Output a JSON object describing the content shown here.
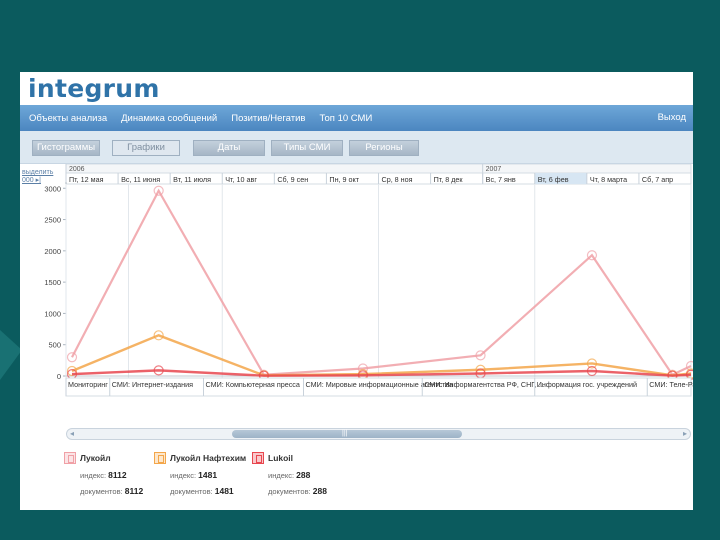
{
  "app": {
    "logo": "integrum"
  },
  "nav": {
    "items": [
      "Объекты анализа",
      "Динамика сообщений",
      "Позитив/Негатив",
      "Топ 10 СМИ"
    ],
    "exit_label": "Выход"
  },
  "toolbar": {
    "buttons": [
      "Гистограммы",
      "Графики",
      "Даты",
      "Типы СМИ",
      "Регионы"
    ],
    "active": "Графики"
  },
  "sidebar": {
    "zoom_label_1": "выделить",
    "zoom_label_2": "000 ▸|"
  },
  "colors": {
    "series_1": "#f0a0a6",
    "series_2": "#f3a64a",
    "series_3": "#e8474f",
    "nav_bg": "#5a93c9"
  },
  "chart_data": {
    "type": "line",
    "years": [
      {
        "label": "2006",
        "start_index": 0
      },
      {
        "label": "2007",
        "start_index": 8
      }
    ],
    "date_labels": [
      "Пт, 12 мая",
      "Вс, 11 июня",
      "Вт, 11 июля",
      "Чт, 10 авг",
      "Сб, 9 сен",
      "Пн, 9 окт",
      "Ср, 8 ноя",
      "Пт, 8 дек",
      "Вс, 7 янв",
      "Вт, 6 фев",
      "Чт, 8 марта",
      "Сб, 7 апр"
    ],
    "highlighted_date": "Вт, 6 фев",
    "yticks": [
      0,
      500,
      1000,
      1500,
      2000,
      2500,
      3000
    ],
    "ylim": [
      0,
      3100
    ],
    "categories": [
      "Мониторинг",
      "СМИ: Интернет-издания",
      "СМИ: Компьютерная пресса",
      "СМИ: Мировые информационные агентства",
      "СМИ: Информагентства РФ, СНГ, ...",
      "Информация гос. учреждений",
      "СМИ: Теле-Радио"
    ],
    "category_bounds": [
      0,
      0.1,
      0.25,
      0.5,
      0.75,
      1.0
    ],
    "x_points": [
      0,
      1,
      2,
      3,
      4,
      5,
      6
    ],
    "series": [
      {
        "name": "Лукойл",
        "values": [
          300,
          2960,
          20,
          120,
          330,
          1930,
          20,
          160
        ]
      },
      {
        "name": "Лукойл Нафтехим",
        "values": [
          80,
          650,
          10,
          30,
          100,
          200,
          10,
          40
        ]
      },
      {
        "name": "Lukoil",
        "values": [
          30,
          90,
          5,
          10,
          40,
          80,
          5,
          20
        ]
      }
    ]
  },
  "legend": [
    {
      "name": "Лукойл",
      "index_label": "индекс:",
      "index_value": "8112",
      "docs_label": "документов:",
      "docs_value": "8112"
    },
    {
      "name": "Лукойл Нафтехим",
      "index_label": "индекс:",
      "index_value": "1481",
      "docs_label": "документов:",
      "docs_value": "1481"
    },
    {
      "name": "Lukoil",
      "index_label": "индекс:",
      "index_value": "288",
      "docs_label": "документов:",
      "docs_value": "288"
    }
  ]
}
